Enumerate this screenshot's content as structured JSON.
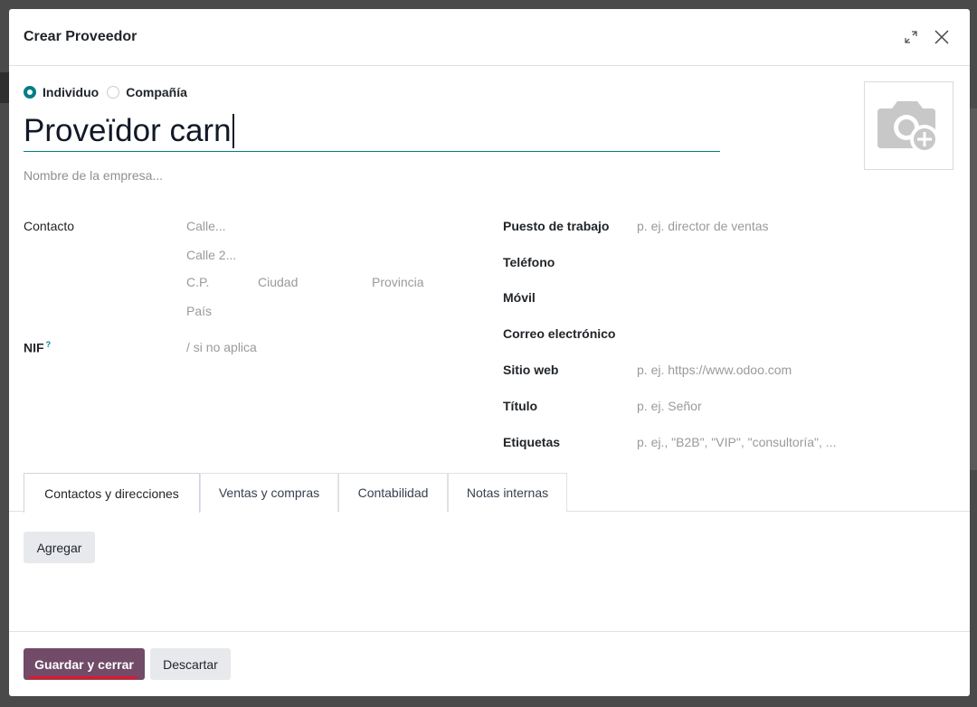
{
  "modal": {
    "title": "Crear Proveedor",
    "expand_icon": "expand-icon",
    "close_icon": "close-icon"
  },
  "type_selector": {
    "options": [
      {
        "label": "Individuo",
        "checked": true
      },
      {
        "label": "Compañía",
        "checked": false
      }
    ]
  },
  "name_field": {
    "value": "Proveïdor carn"
  },
  "company_field": {
    "placeholder": "Nombre de la empresa..."
  },
  "avatar": {
    "icon": "camera-add-icon"
  },
  "left_fields": {
    "contact_label": "Contacto",
    "street_placeholder": "Calle...",
    "street2_placeholder": "Calle 2...",
    "zip_placeholder": "C.P.",
    "city_placeholder": "Ciudad",
    "state_placeholder": "Provincia",
    "country_placeholder": "País",
    "vat_label": "NIF",
    "vat_help": "?",
    "vat_placeholder": "/ si no aplica"
  },
  "right_fields": {
    "job_label": "Puesto de trabajo",
    "job_placeholder": "p. ej. director de ventas",
    "phone_label": "Teléfono",
    "mobile_label": "Móvil",
    "email_label": "Correo electrónico",
    "website_label": "Sitio web",
    "website_placeholder": "p. ej. https://www.odoo.com",
    "title_label": "Título",
    "title_placeholder": "p. ej. Señor",
    "tags_label": "Etiquetas",
    "tags_placeholder": "p. ej., \"B2B\", \"VIP\", \"consultoría\", ..."
  },
  "tabs": [
    {
      "label": "Contactos y direcciones",
      "active": true
    },
    {
      "label": "Ventas y compras",
      "active": false
    },
    {
      "label": "Contabilidad",
      "active": false
    },
    {
      "label": "Notas internas",
      "active": false
    }
  ],
  "contacts_tab": {
    "add_label": "Agregar"
  },
  "footer": {
    "save_label": "Guardar y cerrar",
    "discard_label": "Descartar"
  },
  "colors": {
    "primary": "#714b67",
    "accent": "#017e84",
    "focus_underline": "#e3162b"
  }
}
